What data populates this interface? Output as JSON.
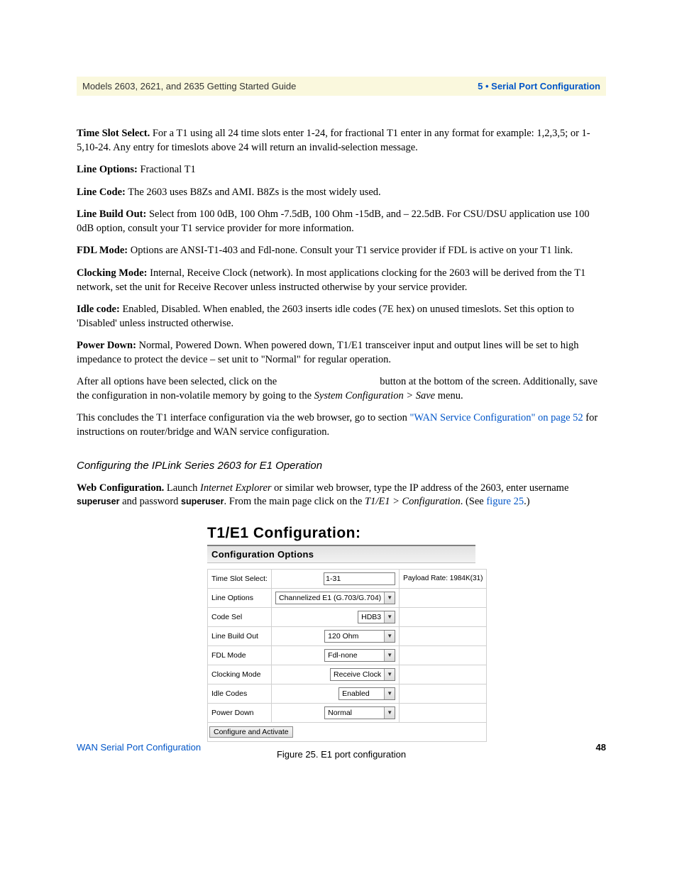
{
  "header": {
    "left": "Models 2603, 2621, and 2635 Getting Started Guide",
    "right": "5 • Serial Port Configuration"
  },
  "body": {
    "p1_b": "Time Slot Select.",
    "p1_t": " For a T1 using all 24 time slots enter 1-24, for fractional T1 enter in any format for example: 1,2,3,5; or 1-5,10-24. Any entry for timeslots above 24 will return an invalid-selection message.",
    "p2_b": "Line Options:",
    "p2_t": " Fractional T1",
    "p3_b": "Line Code:",
    "p3_t": " The 2603 uses B8Zs and AMI. B8Zs is the most widely used.",
    "p4_b": "Line Build Out:",
    "p4_t": " Select from 100 0dB, 100 Ohm -7.5dB, 100 Ohm -15dB, and – 22.5dB. For CSU/DSU application use 100 0dB option, consult your T1 service provider for more information.",
    "p5_b": "FDL Mode:",
    "p5_t": " Options are ANSI-T1-403 and Fdl-none. Consult your T1 service provider if FDL is active on your T1 link.",
    "p6_b": "Clocking Mode:",
    "p6_t": " Internal, Receive Clock (network). In most applications clocking for the 2603 will be derived from the T1 network, set the unit for Receive Recover unless instructed otherwise by your service provider.",
    "p7_b": "Idle code:",
    "p7_t": " Enabled, Disabled. When enabled, the 2603 inserts idle codes (7E hex) on unused timeslots. Set this option to 'Disabled' unless instructed otherwise.",
    "p8_b": "Power Down:",
    "p8_t": " Normal, Powered Down. When powered down, T1/E1 transceiver input and output lines will be set to high impedance to protect the device – set unit to \"Normal\" for regular operation.",
    "p9_a": "After all options have been selected, click on the ",
    "p9_gap": "                                      ",
    "p9_b": " button at the bottom of the screen. Additionally, save the configuration in non-volatile memory by going to the ",
    "p9_i": "System Configuration > Save",
    "p9_c": " menu.",
    "p10_a": "This concludes the T1 interface configuration via the web browser, go to section ",
    "p10_link": "\"WAN Service Configuration\" on page 52",
    "p10_b": " for instructions on router/bridge and WAN service configuration.",
    "subheading": "Configuring the IPLink Series 2603 for E1 Operation",
    "p11_b": "Web Configuration.",
    "p11_a": " Launch ",
    "p11_i1": "Internet Explorer",
    "p11_c": " or similar web browser, type the IP address of the 2603, enter username ",
    "p11_s1": "superuser",
    "p11_d": " and password ",
    "p11_s2": "superuser",
    "p11_e": ". From the main page click on the ",
    "p11_i2": "T1/E1 > Configuration",
    "p11_f": ". (See ",
    "p11_link": "figure 25",
    "p11_g": ".)"
  },
  "config": {
    "title": "T1/E1 Configuration:",
    "subtitle": "Configuration Options",
    "rows": {
      "timeslot_lbl": "Time Slot Select:",
      "timeslot_val": "1-31",
      "payload": "Payload Rate: 1984K(31)",
      "lineopt_lbl": "Line Options",
      "lineopt_val": "Channelized E1 (G.703/G.704)",
      "code_lbl": "Code Sel",
      "code_val": "HDB3",
      "lbo_lbl": "Line Build Out",
      "lbo_val": "120 Ohm",
      "fdl_lbl": "FDL Mode",
      "fdl_val": "Fdl-none",
      "clk_lbl": "Clocking Mode",
      "clk_val": "Receive Clock",
      "idle_lbl": "Idle Codes",
      "idle_val": "Enabled",
      "pwr_lbl": "Power Down",
      "pwr_val": "Normal"
    },
    "button": "Configure and Activate",
    "caption": "Figure 25. E1 port configuration"
  },
  "footer": {
    "left": "WAN Serial Port Configuration",
    "right": "48"
  }
}
